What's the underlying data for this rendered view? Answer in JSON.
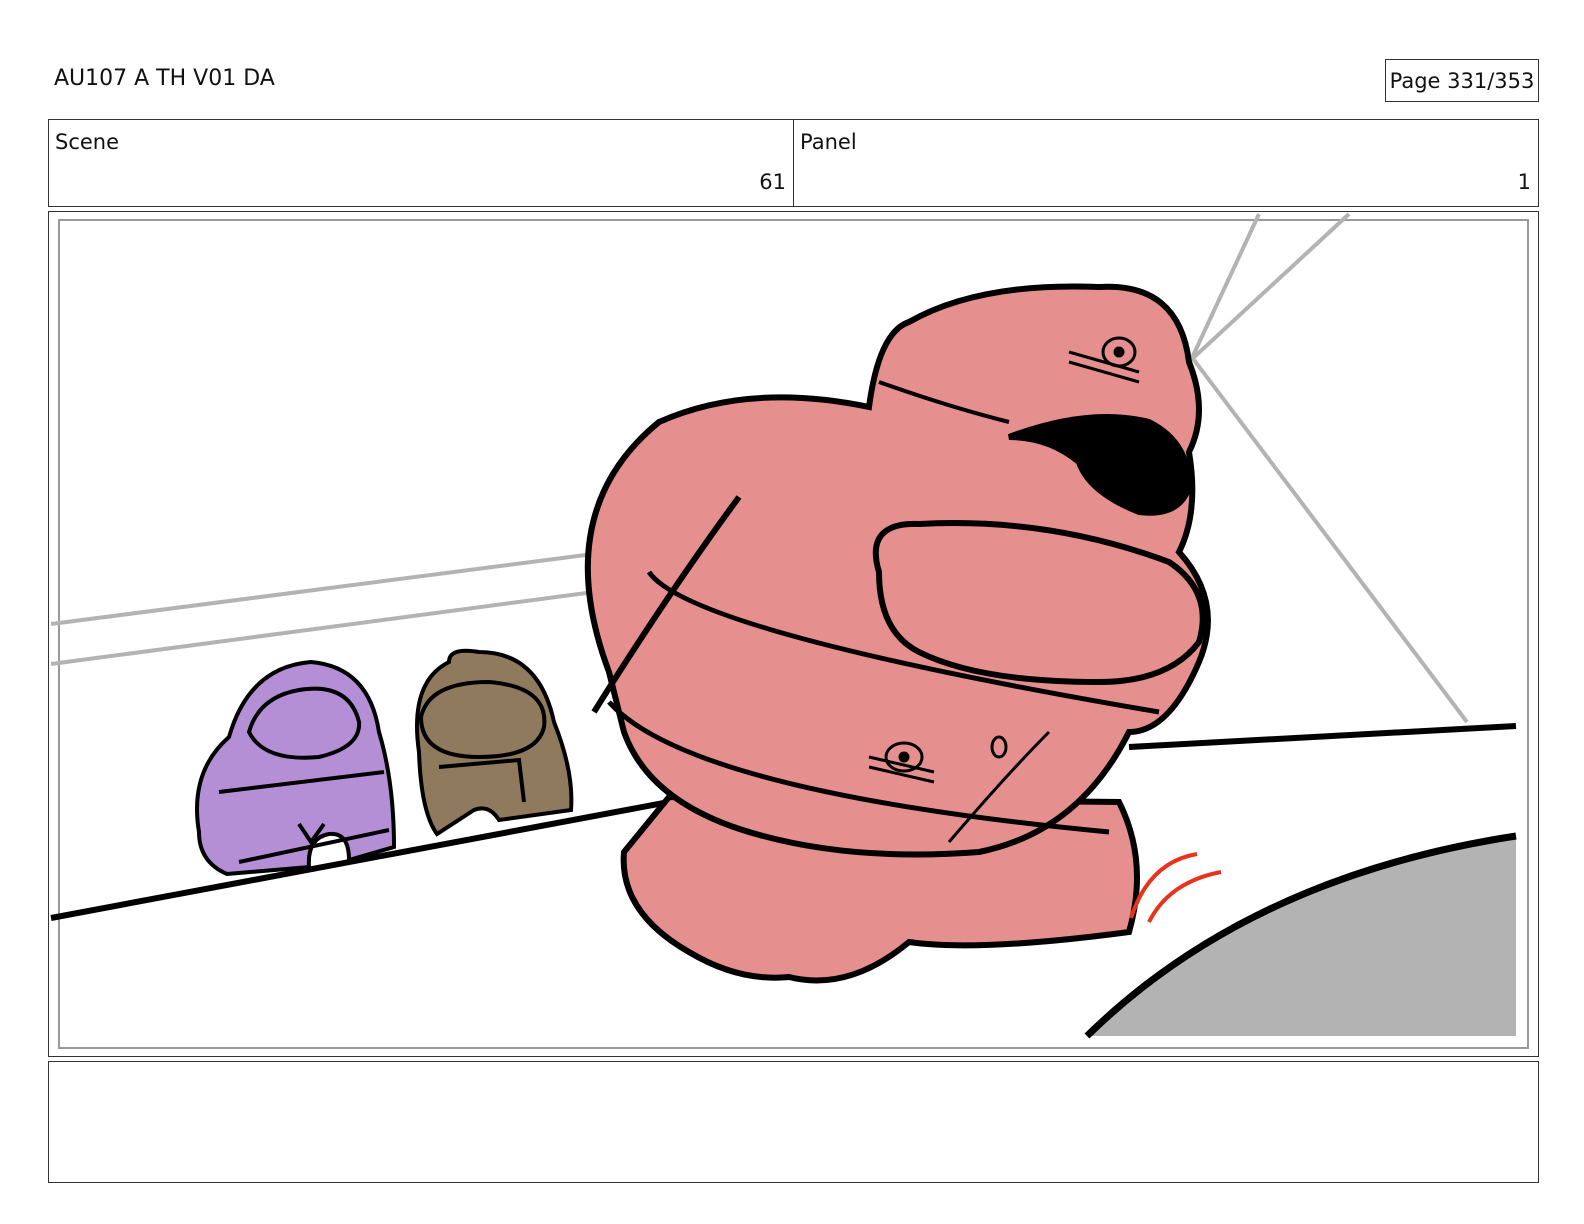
{
  "header": {
    "doc_title": "AU107 A TH V01 DA",
    "page_label": "Page 331/353"
  },
  "info": {
    "scene_label": "Scene",
    "scene_value": "61",
    "panel_label": "Panel",
    "panel_value": "1"
  },
  "notes": {
    "text": ""
  },
  "colors": {
    "pink_crewmate": "#e68f8f",
    "purple_crewmate": "#b48fd6",
    "brown_crewmate": "#8f7a5e",
    "floor_grey": "#b3b3b3",
    "motion_red": "#e8331f"
  }
}
